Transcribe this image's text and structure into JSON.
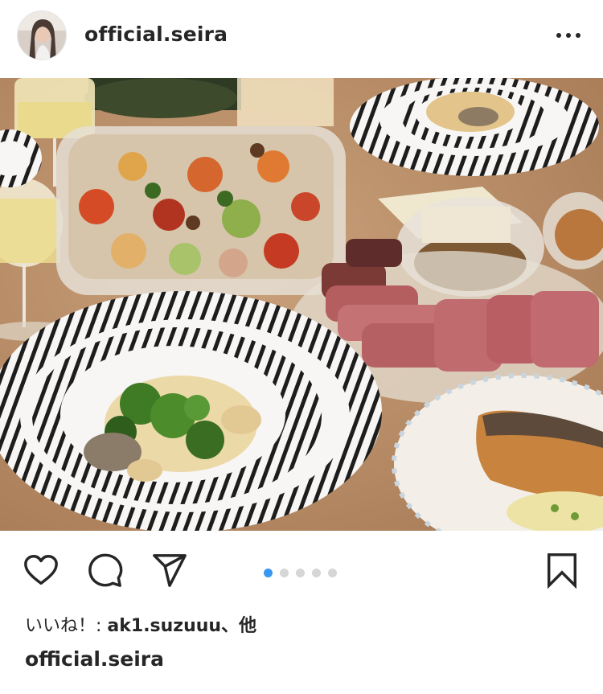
{
  "post": {
    "username": "official.seira",
    "avatar_icon": "profile-avatar",
    "more_icon": "more-options-icon",
    "image_alt": "Dinner table with pasta plates, roasted vegetables, sliced roast beef, fish and cheese",
    "carousel": {
      "count": 5,
      "active_index": 0,
      "active_color": "#3897f0",
      "inactive_color": "#d6d6d6"
    },
    "actions": {
      "like_icon": "heart-icon",
      "comment_icon": "comment-icon",
      "share_icon": "send-icon",
      "save_icon": "bookmark-icon"
    },
    "likes_prefix": "いいね！: ",
    "likes_user": "ak1.suzuuu",
    "likes_suffix": "、他",
    "caption_user": "official.seira"
  }
}
